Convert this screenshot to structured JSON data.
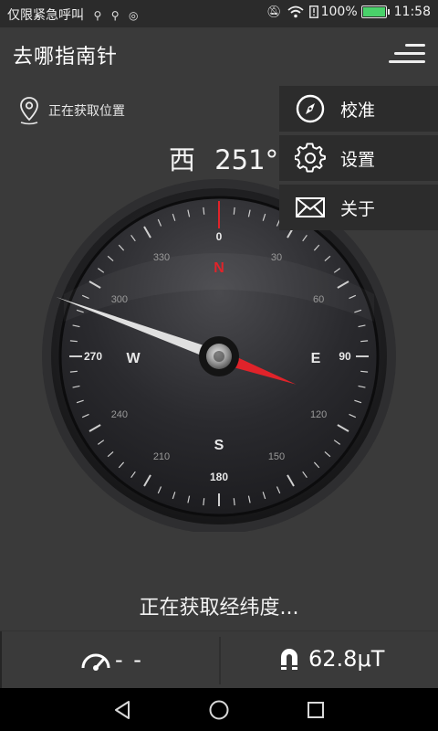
{
  "status_bar": {
    "carrier_text": "仅限紧急呼叫",
    "battery": "100%",
    "time": "11:58"
  },
  "app": {
    "title": "去哪指南针"
  },
  "location": {
    "status": "正在获取位置"
  },
  "heading": {
    "direction": "西",
    "degrees": "251°"
  },
  "compass": {
    "heading_deg": 251,
    "cardinal": {
      "north": "N",
      "east": "E",
      "south": "S",
      "west": "W"
    },
    "degree_labels": [
      "0",
      "30",
      "60",
      "90",
      "120",
      "150",
      "180",
      "210",
      "240",
      "270",
      "300",
      "330"
    ]
  },
  "menu": {
    "items": [
      {
        "label": "校准",
        "icon": "compass-icon"
      },
      {
        "label": "设置",
        "icon": "gear-icon"
      },
      {
        "label": "关于",
        "icon": "mail-icon"
      }
    ]
  },
  "coords": {
    "status": "正在获取经纬度..."
  },
  "speed": {
    "value": "- -"
  },
  "magnetic": {
    "value": "62.8μT"
  },
  "colors": {
    "accent_red": "#e0232a",
    "battery_green": "#49d16a"
  }
}
